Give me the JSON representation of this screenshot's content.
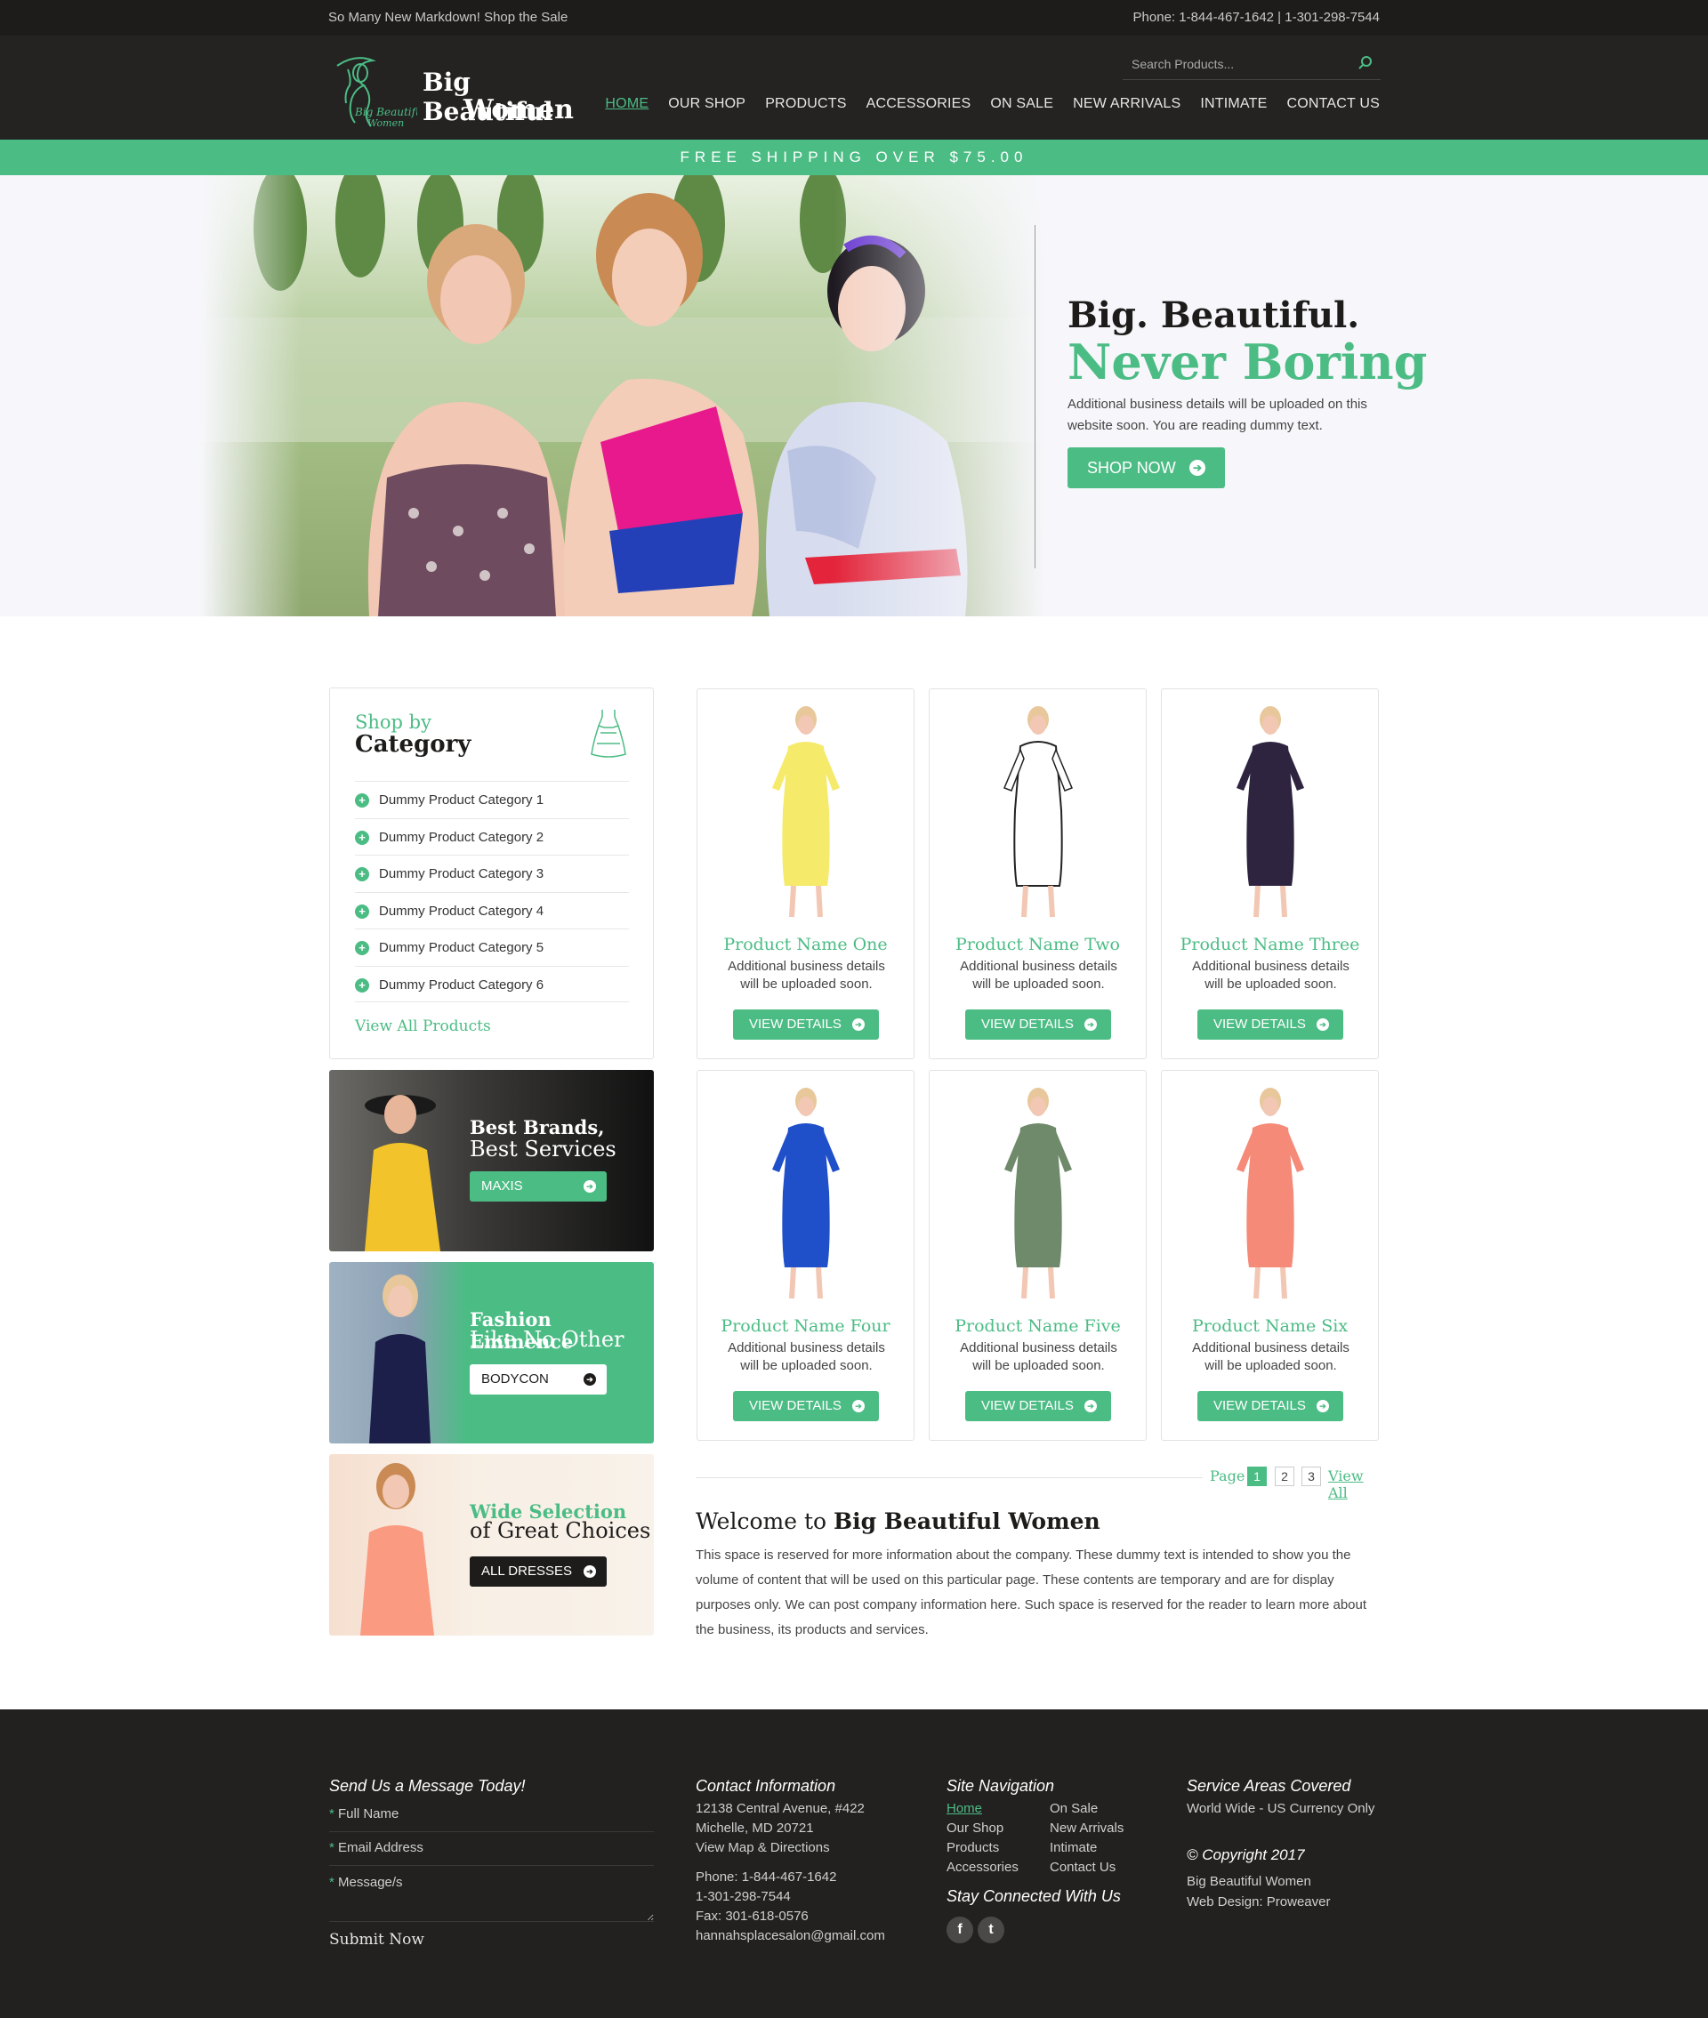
{
  "topbar": {
    "promo": "So Many New Markdown! Shop the Sale",
    "phones": "Phone: 1-844-467-1642 | 1-301-298-7544"
  },
  "header": {
    "brand_line1": "Big Beautiful",
    "brand_line2": "Women",
    "logo_mini_line1": "Big Beautiful",
    "logo_mini_line2": "Women",
    "search_placeholder": "Search Products...",
    "nav": [
      "HOME",
      "OUR SHOP",
      "PRODUCTS",
      "ACCESSORIES",
      "ON SALE",
      "NEW ARRIVALS",
      "INTIMATE",
      "CONTACT US"
    ],
    "active_nav": "HOME"
  },
  "shipping": {
    "text": "FREE SHIPPING OVER $75.00"
  },
  "hero": {
    "title_line1": "Big. Beautiful.",
    "title_line2": "Never Boring",
    "description": "Additional business details will be uploaded on this website soon. You are reading dummy text.",
    "button_label": "SHOP NOW"
  },
  "categories": {
    "title_line1": "Shop by",
    "title_line2": "Category",
    "items": [
      "Dummy Product Category 1",
      "Dummy Product Category 2",
      "Dummy Product Category 3",
      "Dummy Product Category 4",
      "Dummy Product Category 5",
      "Dummy Product Category 6"
    ],
    "view_all": "View All Products"
  },
  "promos": [
    {
      "line1": "Best Brands,",
      "line2": "Best Services",
      "button": "MAXIS"
    },
    {
      "line1": "Fashion Eminence",
      "line2": "Like No Other",
      "button": "BODYCON"
    },
    {
      "line1": "Wide Selection",
      "line2": "of Great Choices",
      "button": "ALL DRESSES"
    }
  ],
  "products": [
    {
      "name": "Product Name One",
      "desc": "Additional business details will be uploaded soon.",
      "button": "VIEW DETAILS",
      "color": "#f5ea6a"
    },
    {
      "name": "Product Name Two",
      "desc": "Additional business details will be uploaded soon.",
      "button": "VIEW DETAILS",
      "color": "#ffffff"
    },
    {
      "name": "Product Name Three",
      "desc": "Additional business details will be uploaded soon.",
      "button": "VIEW DETAILS",
      "color": "#2e2440"
    },
    {
      "name": "Product Name Four",
      "desc": "Additional business details will be uploaded soon.",
      "button": "VIEW DETAILS",
      "color": "#1f4fc9"
    },
    {
      "name": "Product Name Five",
      "desc": "Additional business details will be uploaded soon.",
      "button": "VIEW DETAILS",
      "color": "#6f8a6a"
    },
    {
      "name": "Product Name Six",
      "desc": "Additional business details will be uploaded soon.",
      "button": "VIEW DETAILS",
      "color": "#f58a78"
    }
  ],
  "pagination": {
    "label": "Page",
    "pages": [
      "1",
      "2",
      "3"
    ],
    "current": "1",
    "view_all": "View All"
  },
  "welcome": {
    "title_prefix": "Welcome to",
    "title_brand": "Big Beautiful Women",
    "body": "This space is reserved for more information about the company. These dummy text is intended to show you the volume of content that will be used on this particular page.  These contents are temporary and are for display purposes only. We can post company information here. Such space is reserved for the reader to learn more about the business, its products and services."
  },
  "footer": {
    "message": {
      "title": "Send Us a Message Today!",
      "fields": [
        "Full Name",
        "Email Address",
        "Message/s"
      ],
      "submit": "Submit Now"
    },
    "contact": {
      "title": "Contact Information",
      "address1": "12138 Central Avenue, #422",
      "address2": "Michelle, MD 20721",
      "map": "View Map & Directions",
      "phone1": "Phone: 1-844-467-1642",
      "phone2": "1-301-298-7544",
      "fax": "Fax: 301-618-0576",
      "email": "hannahsplacesalon@gmail.com"
    },
    "sitenav": {
      "title": "Site Navigation",
      "col1": [
        "Home",
        "Our Shop",
        "Products",
        "Accessories"
      ],
      "col2": [
        "On Sale",
        "New Arrivals",
        "Intimate",
        "Contact Us"
      ],
      "stay": "Stay Connected With Us",
      "social": [
        "f",
        "t"
      ]
    },
    "service": {
      "title": "Service Areas Covered",
      "text": "World Wide - US Currency Only",
      "copyright": "© Copyright 2017",
      "company": "Big Beautiful Women",
      "design": "Web Design: Proweaver"
    }
  },
  "colors": {
    "accent": "#4cbc85",
    "dark": "#1d1c1b",
    "header": "#242322",
    "footer": "#222120"
  }
}
